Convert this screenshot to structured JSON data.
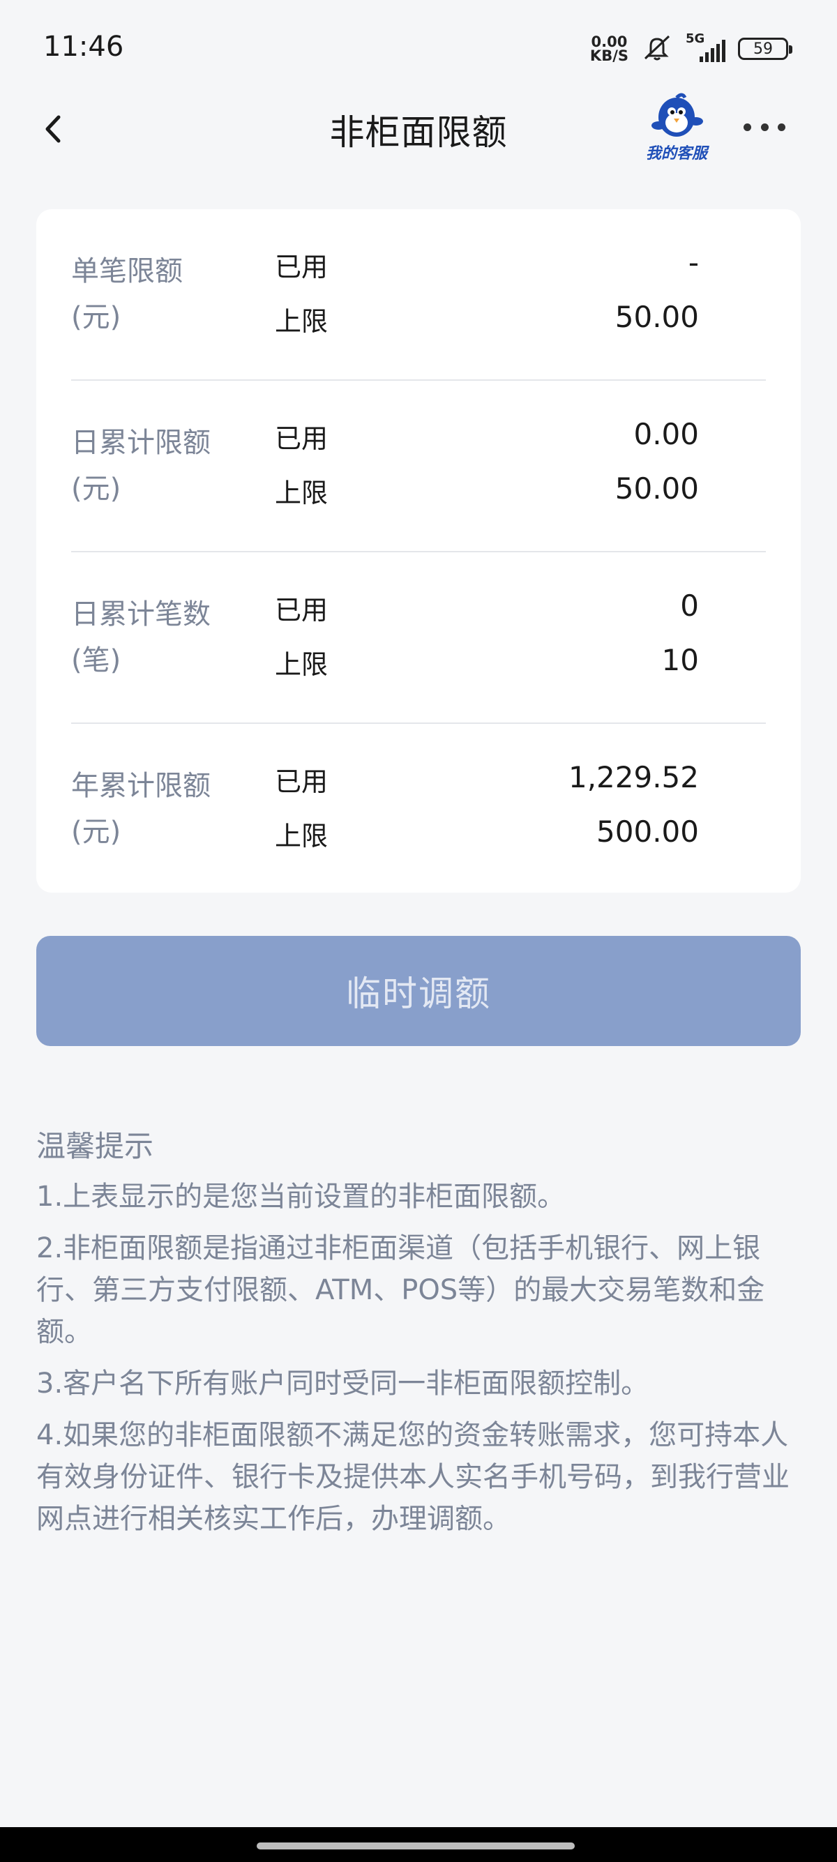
{
  "status_bar": {
    "time": "11:46",
    "net_speed_value": "0.00",
    "net_speed_unit": "KB/S",
    "signal_label": "5G",
    "battery": "59"
  },
  "header": {
    "title": "非柜面限额",
    "service_label": "我的客服"
  },
  "limits": [
    {
      "name": "单笔限额(元)",
      "used_label": "已用",
      "used": "-",
      "cap_label": "上限",
      "cap": "50.00"
    },
    {
      "name": "日累计限额(元)",
      "used_label": "已用",
      "used": "0.00",
      "cap_label": "上限",
      "cap": "50.00"
    },
    {
      "name": "日累计笔数(笔)",
      "used_label": "已用",
      "used": "0",
      "cap_label": "上限",
      "cap": "10"
    },
    {
      "name": "年累计限额(元)",
      "used_label": "已用",
      "used": "1,229.52",
      "cap_label": "上限",
      "cap": "500.00"
    }
  ],
  "adjust_button": "临时调额",
  "tips": {
    "title": "温馨提示",
    "items": [
      "1.上表显示的是您当前设置的非柜面限额。",
      "2.非柜面限额是指通过非柜面渠道（包括手机银行、网上银行、第三方支付限额、ATM、POS等）的最大交易笔数和金额。",
      "3.客户名下所有账户同时受同一非柜面限额控制。",
      "4.如果您的非柜面限额不满足您的资金转账需求，您可持本人有效身份证件、银行卡及提供本人实名手机号码，到我行营业网点进行相关核实工作后，办理调额。"
    ]
  },
  "colors": {
    "page_bg": "#f5f6f8",
    "label_gray": "#7c8597",
    "button_bg": "#889fcb",
    "service_blue": "#1f4fb8"
  }
}
